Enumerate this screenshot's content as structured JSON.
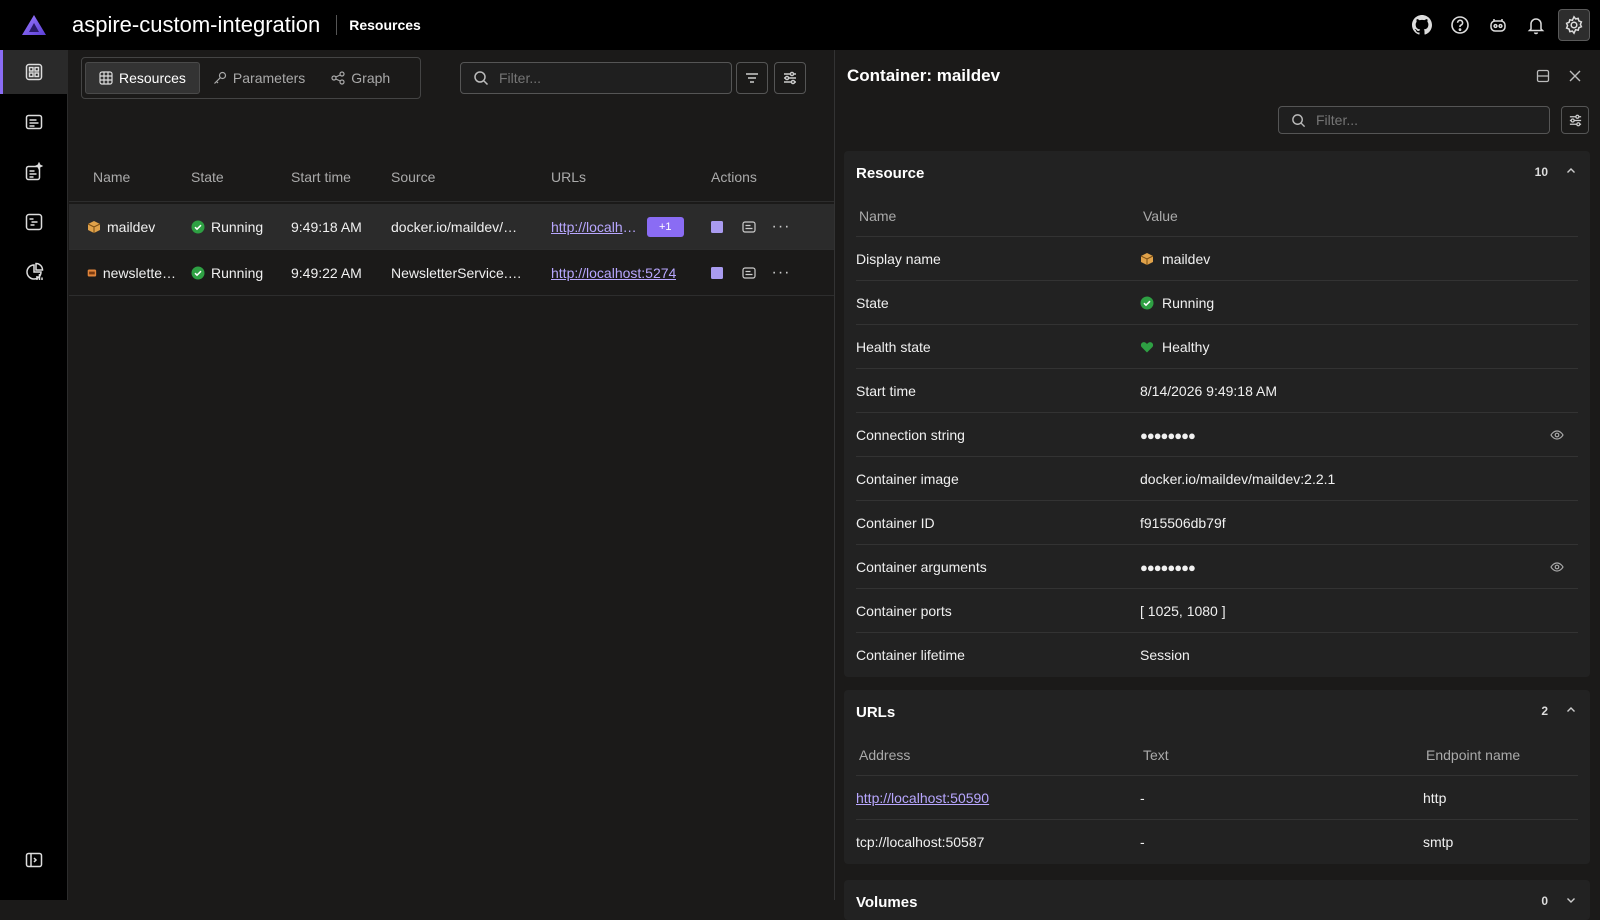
{
  "app": {
    "title": "aspire-custom-integration",
    "page": "Resources"
  },
  "nav": [
    "resources",
    "console",
    "structured-logs",
    "traces",
    "metrics"
  ],
  "toolbar": {
    "tabs": [
      {
        "label": "Resources"
      },
      {
        "label": "Parameters"
      },
      {
        "label": "Graph"
      }
    ],
    "filter_placeholder": "Filter..."
  },
  "grid": {
    "columns": [
      "Name",
      "State",
      "Start time",
      "Source",
      "URLs",
      "Actions"
    ],
    "rows": [
      {
        "name": "maildev",
        "state": "Running",
        "start": "9:49:18 AM",
        "source": "docker.io/maildev/maildev:2.2.1",
        "url": "http://localhost:50590",
        "extra": "+1"
      },
      {
        "name": "newsletterservice",
        "state": "Running",
        "start": "9:49:22 AM",
        "source": "NewsletterService.csproj",
        "url": "http://localhost:5274"
      }
    ]
  },
  "detail": {
    "title": "Container: maildev",
    "filter_placeholder": "Filter...",
    "resource": {
      "title": "Resource",
      "count": "10",
      "headers": [
        "Name",
        "Value"
      ],
      "rows": [
        {
          "k": "Display name",
          "v": "maildev"
        },
        {
          "k": "State",
          "v": "Running"
        },
        {
          "k": "Health state",
          "v": "Healthy"
        },
        {
          "k": "Start time",
          "v": "8/14/2026 9:49:18 AM"
        },
        {
          "k": "Connection string",
          "v": "●●●●●●●●"
        },
        {
          "k": "Container image",
          "v": "docker.io/maildev/maildev:2.2.1"
        },
        {
          "k": "Container ID",
          "v": "f915506db79f"
        },
        {
          "k": "Container arguments",
          "v": "●●●●●●●●"
        },
        {
          "k": "Container ports",
          "v": "[ 1025, 1080 ]"
        },
        {
          "k": "Container lifetime",
          "v": "Session"
        }
      ]
    },
    "urls": {
      "title": "URLs",
      "count": "2",
      "headers": [
        "Address",
        "Text",
        "Endpoint name"
      ],
      "rows": [
        {
          "address": "http://localhost:50590",
          "text": "-",
          "endpoint": "http"
        },
        {
          "address": "tcp://localhost:50587",
          "text": "-",
          "endpoint": "smtp"
        }
      ]
    },
    "volumes": {
      "title": "Volumes",
      "count": "0"
    }
  },
  "colors": {
    "accent": "#8a6cf4",
    "running": "#2ea043",
    "link": "#b8a7ff",
    "background": "#1b1a19"
  }
}
